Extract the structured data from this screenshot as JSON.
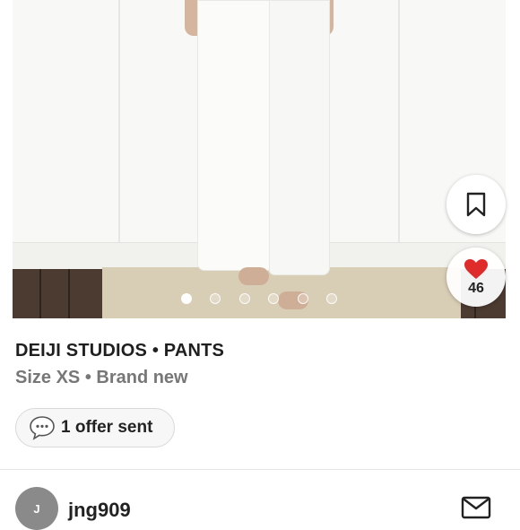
{
  "listing": {
    "photo": {
      "carousel_total": 6,
      "carousel_active": 1
    },
    "like_count": "46",
    "title": "DEIJI STUDIOS • PANTS",
    "subtitle": "Size XS • Brand new",
    "offer_label": "1 offer sent"
  },
  "seller": {
    "avatar_initial": "J",
    "username": "jng909"
  },
  "colors": {
    "heart": "#e02b2b",
    "title": "#1f1f1f",
    "subtitle": "#777777",
    "avatar": "#8a8a8a"
  },
  "icons": {
    "bookmark": "bookmark-icon",
    "like": "heart-icon",
    "offer": "chat-bubble-icon",
    "message": "mail-icon"
  }
}
